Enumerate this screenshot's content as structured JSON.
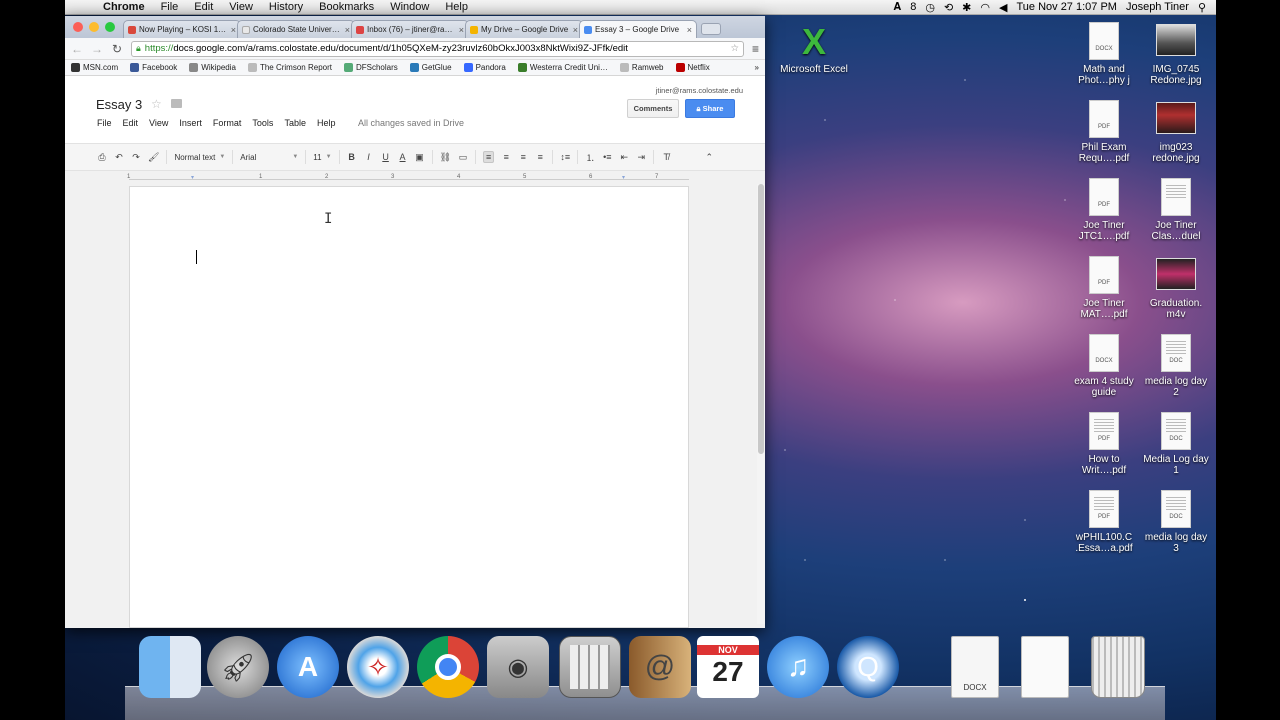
{
  "menubar": {
    "app": "Chrome",
    "items": [
      "File",
      "Edit",
      "View",
      "History",
      "Bookmarks",
      "Window",
      "Help"
    ],
    "adobe_count": "8",
    "datetime": "Tue Nov 27  1:07 PM",
    "user": "Joseph Tiner"
  },
  "tabs": [
    {
      "title": "Now Playing – KOSI 10…",
      "color": "#d9483b"
    },
    {
      "title": "Colorado State Universi…",
      "color": "#e8e8e8"
    },
    {
      "title": "Inbox (76) – jtiner@ram…",
      "color": "#d44"
    },
    {
      "title": "My Drive – Google Drive",
      "color": "#f4b400"
    },
    {
      "title": "Essay 3 – Google Drive",
      "color": "#4a8cf0"
    }
  ],
  "address": {
    "scheme": "https://",
    "rest": "docs.google.com/a/rams.colostate.edu/document/d/1h05QXeM-zy23ruvlz60bOkxJ003x8NktWixi9Z-JFfk/edit"
  },
  "bookmarks": [
    {
      "label": "MSN.com",
      "color": "#333"
    },
    {
      "label": "Facebook",
      "color": "#3b5998"
    },
    {
      "label": "Wikipedia",
      "color": "#888"
    },
    {
      "label": "The Crimson Report",
      "color": "#bbb"
    },
    {
      "label": "DFScholars",
      "color": "#5a7"
    },
    {
      "label": "GetGlue",
      "color": "#2a7ab8"
    },
    {
      "label": "Pandora",
      "color": "#3668ff"
    },
    {
      "label": "Westerra Credit Uni…",
      "color": "#3a7d2a"
    },
    {
      "label": "Ramweb",
      "color": "#bbb"
    },
    {
      "label": "Netflix",
      "color": "#b00"
    }
  ],
  "doc": {
    "title": "Essay 3",
    "menu": [
      "File",
      "Edit",
      "View",
      "Insert",
      "Format",
      "Tools",
      "Table",
      "Help"
    ],
    "saved": "All changes saved in Drive",
    "user": "jtiner@rams.colostate.edu",
    "comments": "Comments",
    "share": "Share",
    "style": "Normal text",
    "font": "Arial",
    "size": "11",
    "ruler": [
      "1",
      "1",
      "2",
      "3",
      "4",
      "5",
      "6",
      "7"
    ]
  },
  "desktop": [
    {
      "label": "Microsoft Excel",
      "type": "excel"
    },
    {
      "label": "Math and Phot…phy j",
      "type": "DOCX"
    },
    {
      "label": "IMG_0745 Redone.jpg",
      "type": "img"
    },
    {
      "label": "Phil Exam Requ….pdf",
      "type": "PDF"
    },
    {
      "label": "img023 redone.jpg",
      "type": "img"
    },
    {
      "label": "Joe Tiner JTC1….pdf",
      "type": "PDF"
    },
    {
      "label": "Joe Tiner Clas…duel",
      "type": "doc"
    },
    {
      "label": "Joe Tiner MAT….pdf",
      "type": "PDF"
    },
    {
      "label": "Graduation. m4v",
      "type": "video"
    },
    {
      "label": "exam 4 study guide",
      "type": "DOCX"
    },
    {
      "label": "media log day 2",
      "type": "DOC"
    },
    {
      "label": "How to Writ….pdf",
      "type": "PDF"
    },
    {
      "label": "Media Log day 1",
      "type": "DOC"
    },
    {
      "label": "wPHIL100.C .Essa…a.pdf",
      "type": "PDF"
    },
    {
      "label": "media log day 3",
      "type": "DOC"
    }
  ],
  "dock": {
    "calendar_month": "NOV",
    "calendar_day": "27",
    "docx_label": "DOCX"
  }
}
